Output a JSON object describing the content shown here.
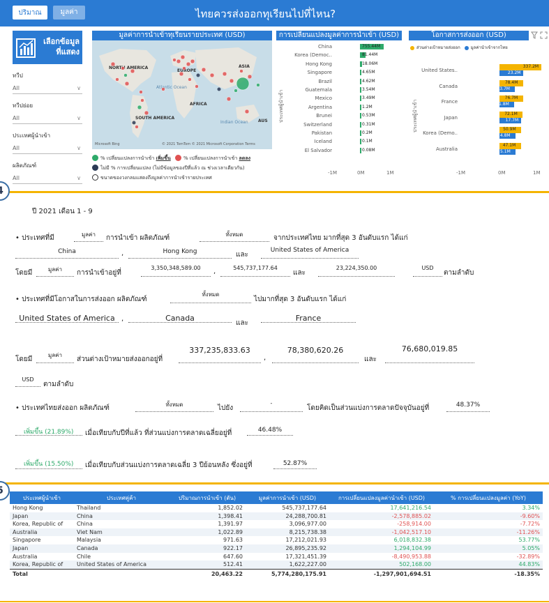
{
  "header": {
    "title": "ไทยควรส่งออกทุเรียนไปที่ไหน?",
    "btn_volume": "ปริมาณ",
    "btn_value": "มูลค่า"
  },
  "sidebar": {
    "logo_line1": "เลือกข้อมูล",
    "logo_line2": "ที่แสดง",
    "filters": [
      {
        "label": "ทวีป",
        "value": "All"
      },
      {
        "label": "ทวีปย่อย",
        "value": "All"
      },
      {
        "label": "ประเทศผู้นำเข้า",
        "value": "All"
      },
      {
        "label": "ผลิตภัณฑ์",
        "value": "All"
      }
    ]
  },
  "map": {
    "title": "มูลค่าการนำเข้าทุเรียนรายประเทศ (USD)",
    "labels": [
      "NORTH AMERICA",
      "EUROPE",
      "ASIA",
      "AFRICA",
      "SOUTH AMERICA",
      "AUS"
    ],
    "oceans": [
      "Atlantic Ocean",
      "Indian Ocean"
    ],
    "copyright": "© 2021 TomTom © 2021 Microsoft Corporation  Terms",
    "msft": "Microsoft Bing",
    "legend_increase": "% เปลี่ยนแปลงการนำเข้า",
    "legend_increase_tag": "เพิ่มขึ้น",
    "legend_decrease": "% เปลี่ยนแปลงการนำเข้า",
    "legend_decrease_tag": "ลดลง",
    "legend_nochange": "ไม่มี % การเปลี่ยนแปลง (ไม่มีข้อมูลของปีที่แล้ว ณ ช่วงเวลาเดียวกัน)",
    "legend_size": "ขนาดของวงกลมแสดงถึงมูลค่าการนำเข้ารายประเทศ"
  },
  "change_chart": {
    "title": "การเปลี่ยนแปลงมูลค่าการนำเข้า (USD)",
    "ylabel": "ประเทศผู้นำเข้า",
    "ticks": [
      "-1M",
      "0M",
      "1M"
    ]
  },
  "opp_chart": {
    "title": "โอกาสการส่งออก (USD)",
    "legend_a": "ส่วนต่างเป้าหมายส่งออก",
    "legend_b": "มูลค่านำเข้าจากไทย",
    "ylabel": "ประเทศผู้นำเข้า",
    "ticks": [
      "-1M",
      "0M",
      "1M"
    ]
  },
  "chart_data": [
    {
      "type": "bar",
      "title": "การเปลี่ยนแปลงมูลค่าการนำเข้า (USD)",
      "categories": [
        "China",
        "Korea (Democ..",
        "Hong Kong",
        "Singapore",
        "Brazil",
        "Guatemala",
        "Mexico",
        "Argentina",
        "Brunei",
        "Switzerland",
        "Pakistan",
        "Iceland",
        "El Salvador"
      ],
      "values": [
        755.44,
        81.44,
        18.06,
        4.65,
        4.62,
        3.54,
        3.49,
        1.2,
        0.53,
        0.31,
        0.2,
        0.1,
        0.08
      ],
      "labels": [
        "755.44M",
        "81.44M",
        "18.06M",
        "4.65M",
        "4.62M",
        "3.54M",
        "3.49M",
        "1.2M",
        "0.53M",
        "0.31M",
        "0.2M",
        "0.1M",
        "0.08M"
      ],
      "ylabel": "ประเทศผู้นำเข้า"
    },
    {
      "type": "bar",
      "title": "โอกาสการส่งออก (USD)",
      "categories": [
        "United States..",
        "Canada",
        "France",
        "Japan",
        "Korea (Demo..",
        "Australia"
      ],
      "series": [
        {
          "name": "ส่วนต่างเป้าหมายส่งออก",
          "values": [
            337.2,
            78.4,
            76.7,
            72.1,
            50.9,
            47.1
          ],
          "labels": [
            "337.2M",
            "78.4M",
            "76.7M",
            "72.1M",
            "50.9M",
            "47.1M"
          ]
        },
        {
          "name": "มูลค่านำเข้าจากไทย",
          "values": [
            23.2,
            3.7,
            1.8,
            17.7,
            4.8,
            5.1
          ],
          "labels": [
            "23.2M",
            "3.7M",
            "1.8M",
            "17.7M",
            "4.8M",
            "5.1M"
          ]
        }
      ],
      "ylabel": "ประเทศผู้นำเข้า"
    }
  ],
  "markers": {
    "left": "4",
    "right": "5"
  },
  "summary": {
    "period": "ปี 2021  เดือน 1 - 9",
    "s1_prefix": "•  ประเทศที่มี",
    "s1_metric": "มูลค่า",
    "s1_mid": "การนำเข้า ผลิตภัณฑ์",
    "s1_product": "ทั้งหมด",
    "s1_suffix": "จากประเทศไทย มากที่สุด 3 อันดับแรก ได้แก่",
    "top_import": [
      "China",
      "Hong Kong",
      "United States of America"
    ],
    "and": "และ",
    "by_prefix": "โดยมี",
    "s1_metric2": "มูลค่า",
    "s1_by_mid": "การนำเข้าอยู่ที่",
    "import_values": [
      "3,350,348,589.00",
      "545,737,177.64",
      "23,224,350.00"
    ],
    "unit": "USD",
    "respectively": "ตามลำดับ",
    "s2_prefix": "•  ประเทศที่มีโอกาสในการส่งออก ผลิตภัณฑ์",
    "s2_product": "ทั้งหมด",
    "s2_suffix": "ไปมากที่สุด 3 อันดับแรก ได้แก่",
    "top_opp": [
      "United States of America",
      "Canada",
      "France"
    ],
    "s2_metric": "มูลค่า",
    "s2_by_mid": "ส่วนต่างเป้าหมายส่งออกอยู่ที่",
    "opp_values": [
      "337,235,833.63",
      "78,380,620.26",
      "76,680,019.85"
    ],
    "s3_prefix": "•  ประเทศไทยส่งออก ผลิตภัณฑ์",
    "s3_product": "ทั้งหมด",
    "s3_mid": "ไปยัง",
    "s3_dest": "-",
    "s3_suffix": "โดยคิดเป็นส่วนแบ่งการตลาดปัจจุบันอยู่ที่",
    "market_share": "48.37%",
    "change_yoy": "เพิ่มขึ้น (21.89%)",
    "s4_mid": "เมื่อเทียบกับปีที่แล้ว ที่ส่วนแบ่งการตลาดเฉลี่ยอยู่ที่",
    "share_last_year": "46.48%",
    "change_3y": "เพิ่มขึ้น (15.50%)",
    "s5_mid": "เมื่อเทียบกับส่วนแบ่งการตลาดเฉลี่ย 3 ปีย้อนหลัง ซึ่งอยู่ที่",
    "share_3y": "52.87%"
  },
  "table": {
    "headers": [
      "ประเทศผู้นำเข้า",
      "ประเทศคู่ค้า",
      "ปริมาณการนำเข้า (ตัน)",
      "มูลค่าการนำเข้า (USD)",
      "การเปลี่ยนแปลงมูลค่านำเข้า (USD)",
      "% การเปลี่ยนแปลงมูลค่า (YoY)"
    ],
    "rows": [
      [
        "Hong Kong",
        "Thailand",
        "1,852.02",
        "545,737,177.64",
        "17,641,216.54",
        "3.34%"
      ],
      [
        "Japan",
        "China",
        "1,398.41",
        "24,288,700.81",
        "-2,578,885.02",
        "-9.60%"
      ],
      [
        "Korea, Republic of",
        "China",
        "1,391.97",
        "3,096,977.00",
        "-258,914.00",
        "-7.72%"
      ],
      [
        "Australia",
        "Viet Nam",
        "1,022.89",
        "8,215,738.38",
        "-1,042,517.10",
        "-11.26%"
      ],
      [
        "Singapore",
        "Malaysia",
        "971.63",
        "17,212,021.93",
        "6,018,832.38",
        "53.77%"
      ],
      [
        "Japan",
        "Canada",
        "922.17",
        "26,895,235.92",
        "1,294,104.99",
        "5.05%"
      ],
      [
        "Australia",
        "Chile",
        "647.60",
        "17,321,451.39",
        "-8,490,953.88",
        "-32.89%"
      ],
      [
        "Korea, Republic of",
        "United States of America",
        "512.41",
        "1,622,227.00",
        "502,168.00",
        "44.83%"
      ]
    ],
    "total": [
      "Total",
      "",
      "20,463.22",
      "5,774,280,175.91",
      "-1,297,901,694.51",
      "-18.35%"
    ]
  },
  "colors": {
    "accent": "#2b7bd3",
    "green": "#2eaa6a",
    "red": "#e05252",
    "yellow": "#f4b400",
    "navy": "#2b3a55"
  }
}
